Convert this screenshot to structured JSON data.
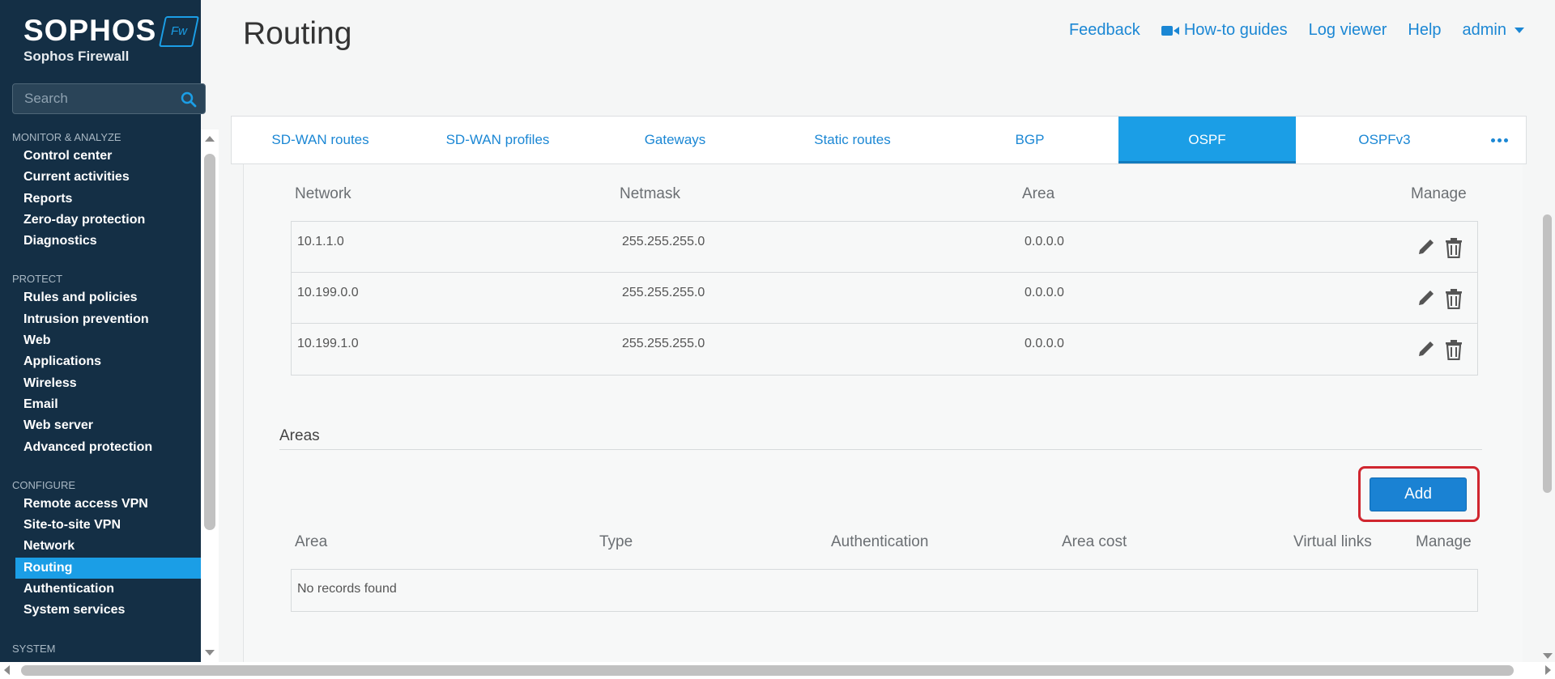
{
  "brand": {
    "name": "SOPHOS",
    "product": "Sophos Firewall",
    "badge": "Fw"
  },
  "search": {
    "placeholder": "Search"
  },
  "sidebar": {
    "sections": [
      {
        "title": "MONITOR & ANALYZE",
        "items": [
          "Control center",
          "Current activities",
          "Reports",
          "Zero-day protection",
          "Diagnostics"
        ]
      },
      {
        "title": "PROTECT",
        "items": [
          "Rules and policies",
          "Intrusion prevention",
          "Web",
          "Applications",
          "Wireless",
          "Email",
          "Web server",
          "Advanced protection"
        ]
      },
      {
        "title": "CONFIGURE",
        "items": [
          "Remote access VPN",
          "Site-to-site VPN",
          "Network",
          "Routing",
          "Authentication",
          "System services"
        ]
      },
      {
        "title": "SYSTEM",
        "items": []
      }
    ],
    "active_item": "Routing"
  },
  "header": {
    "title": "Routing",
    "links": {
      "feedback": "Feedback",
      "howto": "How-to guides",
      "logviewer": "Log viewer",
      "help": "Help",
      "user": "admin"
    }
  },
  "tabs": [
    "SD-WAN routes",
    "SD-WAN profiles",
    "Gateways",
    "Static routes",
    "BGP",
    "OSPF",
    "OSPFv3"
  ],
  "active_tab": "OSPF",
  "networks": {
    "columns": {
      "network": "Network",
      "netmask": "Netmask",
      "area": "Area",
      "manage": "Manage"
    },
    "rows": [
      {
        "network": "10.1.1.0",
        "netmask": "255.255.255.0",
        "area": "0.0.0.0"
      },
      {
        "network": "10.199.0.0",
        "netmask": "255.255.255.0",
        "area": "0.0.0.0"
      },
      {
        "network": "10.199.1.0",
        "netmask": "255.255.255.0",
        "area": "0.0.0.0"
      }
    ]
  },
  "areas": {
    "title": "Areas",
    "add_label": "Add",
    "columns": {
      "area": "Area",
      "type": "Type",
      "authentication": "Authentication",
      "area_cost": "Area cost",
      "virtual_links": "Virtual links",
      "manage": "Manage"
    },
    "empty_text": "No records found"
  },
  "colors": {
    "sidebar_bg": "#142f45",
    "accent": "#1b9ee6",
    "link": "#1b87d4",
    "highlight": "#d0262f"
  }
}
